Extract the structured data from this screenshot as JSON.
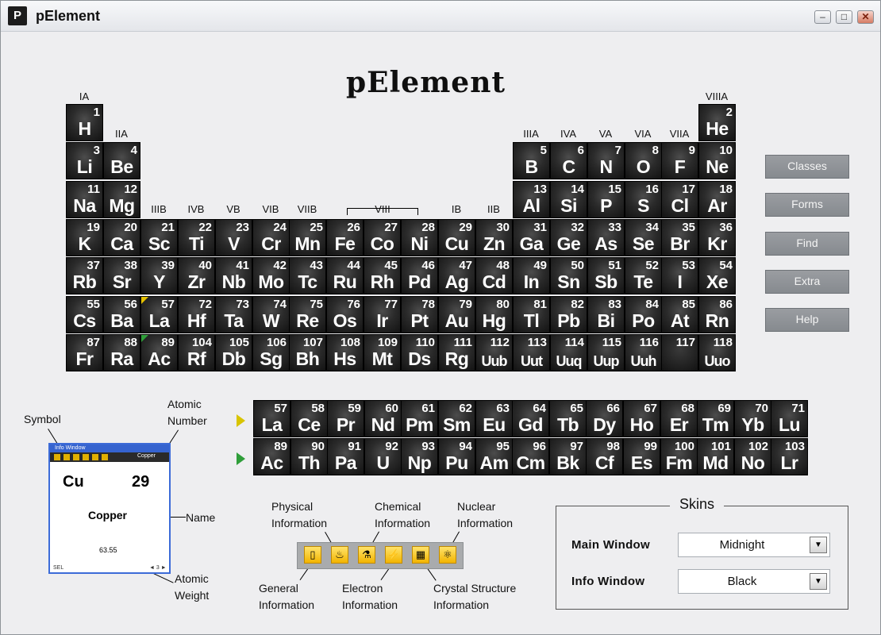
{
  "window": {
    "title": "pElement",
    "app_icon_letter": "P"
  },
  "logo": "pElement",
  "groups": [
    "IA",
    "IIA",
    "IIIB",
    "IVB",
    "VB",
    "VIB",
    "VIIB",
    "VIII",
    "IB",
    "IIB",
    "IIIA",
    "IVA",
    "VA",
    "VIA",
    "VIIA",
    "VIIIA"
  ],
  "elements": [
    {
      "n": "1",
      "s": "H"
    },
    {
      "n": "2",
      "s": "He"
    },
    {
      "n": "3",
      "s": "Li"
    },
    {
      "n": "4",
      "s": "Be"
    },
    {
      "n": "5",
      "s": "B"
    },
    {
      "n": "6",
      "s": "C"
    },
    {
      "n": "7",
      "s": "N"
    },
    {
      "n": "8",
      "s": "O"
    },
    {
      "n": "9",
      "s": "F"
    },
    {
      "n": "10",
      "s": "Ne"
    },
    {
      "n": "11",
      "s": "Na"
    },
    {
      "n": "12",
      "s": "Mg"
    },
    {
      "n": "13",
      "s": "Al"
    },
    {
      "n": "14",
      "s": "Si"
    },
    {
      "n": "15",
      "s": "P"
    },
    {
      "n": "16",
      "s": "S"
    },
    {
      "n": "17",
      "s": "Cl"
    },
    {
      "n": "18",
      "s": "Ar"
    },
    {
      "n": "19",
      "s": "K"
    },
    {
      "n": "20",
      "s": "Ca"
    },
    {
      "n": "21",
      "s": "Sc"
    },
    {
      "n": "22",
      "s": "Ti"
    },
    {
      "n": "23",
      "s": "V"
    },
    {
      "n": "24",
      "s": "Cr"
    },
    {
      "n": "25",
      "s": "Mn"
    },
    {
      "n": "26",
      "s": "Fe"
    },
    {
      "n": "27",
      "s": "Co"
    },
    {
      "n": "28",
      "s": "Ni"
    },
    {
      "n": "29",
      "s": "Cu"
    },
    {
      "n": "30",
      "s": "Zn"
    },
    {
      "n": "31",
      "s": "Ga"
    },
    {
      "n": "32",
      "s": "Ge"
    },
    {
      "n": "33",
      "s": "As"
    },
    {
      "n": "34",
      "s": "Se"
    },
    {
      "n": "35",
      "s": "Br"
    },
    {
      "n": "36",
      "s": "Kr"
    },
    {
      "n": "37",
      "s": "Rb"
    },
    {
      "n": "38",
      "s": "Sr"
    },
    {
      "n": "39",
      "s": "Y"
    },
    {
      "n": "40",
      "s": "Zr"
    },
    {
      "n": "41",
      "s": "Nb"
    },
    {
      "n": "42",
      "s": "Mo"
    },
    {
      "n": "43",
      "s": "Tc"
    },
    {
      "n": "44",
      "s": "Ru"
    },
    {
      "n": "45",
      "s": "Rh"
    },
    {
      "n": "46",
      "s": "Pd"
    },
    {
      "n": "47",
      "s": "Ag"
    },
    {
      "n": "48",
      "s": "Cd"
    },
    {
      "n": "49",
      "s": "In"
    },
    {
      "n": "50",
      "s": "Sn"
    },
    {
      "n": "51",
      "s": "Sb"
    },
    {
      "n": "52",
      "s": "Te"
    },
    {
      "n": "53",
      "s": "I"
    },
    {
      "n": "54",
      "s": "Xe"
    },
    {
      "n": "55",
      "s": "Cs"
    },
    {
      "n": "56",
      "s": "Ba"
    },
    {
      "n": "57",
      "s": "La",
      "mark": "#e6c200"
    },
    {
      "n": "72",
      "s": "Hf"
    },
    {
      "n": "73",
      "s": "Ta"
    },
    {
      "n": "74",
      "s": "W"
    },
    {
      "n": "75",
      "s": "Re"
    },
    {
      "n": "76",
      "s": "Os"
    },
    {
      "n": "77",
      "s": "Ir"
    },
    {
      "n": "78",
      "s": "Pt"
    },
    {
      "n": "79",
      "s": "Au"
    },
    {
      "n": "80",
      "s": "Hg"
    },
    {
      "n": "81",
      "s": "Tl"
    },
    {
      "n": "82",
      "s": "Pb"
    },
    {
      "n": "83",
      "s": "Bi"
    },
    {
      "n": "84",
      "s": "Po"
    },
    {
      "n": "85",
      "s": "At"
    },
    {
      "n": "86",
      "s": "Rn"
    },
    {
      "n": "87",
      "s": "Fr"
    },
    {
      "n": "88",
      "s": "Ra"
    },
    {
      "n": "89",
      "s": "Ac",
      "mark": "#2f9e3a"
    },
    {
      "n": "104",
      "s": "Rf"
    },
    {
      "n": "105",
      "s": "Db"
    },
    {
      "n": "106",
      "s": "Sg"
    },
    {
      "n": "107",
      "s": "Bh"
    },
    {
      "n": "108",
      "s": "Hs"
    },
    {
      "n": "109",
      "s": "Mt"
    },
    {
      "n": "110",
      "s": "Ds"
    },
    {
      "n": "111",
      "s": "Rg"
    },
    {
      "n": "112",
      "s": "Uub"
    },
    {
      "n": "113",
      "s": "Uut"
    },
    {
      "n": "114",
      "s": "Uuq"
    },
    {
      "n": "115",
      "s": "Uup"
    },
    {
      "n": "116",
      "s": "Uuh"
    },
    {
      "n": "117",
      "s": ""
    },
    {
      "n": "118",
      "s": "Uuo"
    },
    {
      "n": "57",
      "s": "La"
    },
    {
      "n": "58",
      "s": "Ce"
    },
    {
      "n": "59",
      "s": "Pr"
    },
    {
      "n": "60",
      "s": "Nd"
    },
    {
      "n": "61",
      "s": "Pm"
    },
    {
      "n": "62",
      "s": "Sm"
    },
    {
      "n": "63",
      "s": "Eu"
    },
    {
      "n": "64",
      "s": "Gd"
    },
    {
      "n": "65",
      "s": "Tb"
    },
    {
      "n": "66",
      "s": "Dy"
    },
    {
      "n": "67",
      "s": "Ho"
    },
    {
      "n": "68",
      "s": "Er"
    },
    {
      "n": "69",
      "s": "Tm"
    },
    {
      "n": "70",
      "s": "Yb"
    },
    {
      "n": "71",
      "s": "Lu"
    },
    {
      "n": "89",
      "s": "Ac"
    },
    {
      "n": "90",
      "s": "Th"
    },
    {
      "n": "91",
      "s": "Pa"
    },
    {
      "n": "92",
      "s": "U"
    },
    {
      "n": "93",
      "s": "Np"
    },
    {
      "n": "94",
      "s": "Pu"
    },
    {
      "n": "95",
      "s": "Am"
    },
    {
      "n": "96",
      "s": "Cm"
    },
    {
      "n": "97",
      "s": "Bk"
    },
    {
      "n": "98",
      "s": "Cf"
    },
    {
      "n": "99",
      "s": "Es"
    },
    {
      "n": "100",
      "s": "Fm"
    },
    {
      "n": "101",
      "s": "Md"
    },
    {
      "n": "102",
      "s": "No"
    },
    {
      "n": "103",
      "s": "Lr"
    }
  ],
  "series_arrows": [
    {
      "color": "#d8c400"
    },
    {
      "color": "#2f9e3a"
    }
  ],
  "side_buttons": [
    "Classes",
    "Forms",
    "Find",
    "Extra",
    "Help"
  ],
  "annotations": {
    "symbol": "Symbol",
    "atomic_number": "Atomic\nNumber",
    "name": "Name",
    "atomic_weight": "Atomic\nWeight",
    "physical": "Physical\nInformation",
    "chemical": "Chemical\nInformation",
    "nuclear": "Nuclear\nInformation",
    "general": "General\nInformation",
    "electron": "Electron\nInformation",
    "crystal": "Crystal Structure\nInformation"
  },
  "mini_window": {
    "title": "Info Window",
    "toolbar_name": "Copper",
    "symbol": "Cu",
    "number": "29",
    "name": "Copper",
    "weight": "63.55",
    "selection": "SEL",
    "nav": "◄ 3 ►"
  },
  "info_icons": [
    {
      "name": "general-info-icon",
      "glyph": "▯"
    },
    {
      "name": "physical-info-icon",
      "glyph": "♨"
    },
    {
      "name": "chemical-info-icon",
      "glyph": "⚗"
    },
    {
      "name": "electron-info-icon",
      "glyph": "⚡"
    },
    {
      "name": "crystal-info-icon",
      "glyph": "▦"
    },
    {
      "name": "nuclear-info-icon",
      "glyph": "⚛"
    }
  ],
  "skins": {
    "title": "Skins",
    "main_label": "Main Window",
    "main_value": "Midnight",
    "info_label": "Info Window",
    "info_value": "Black"
  }
}
